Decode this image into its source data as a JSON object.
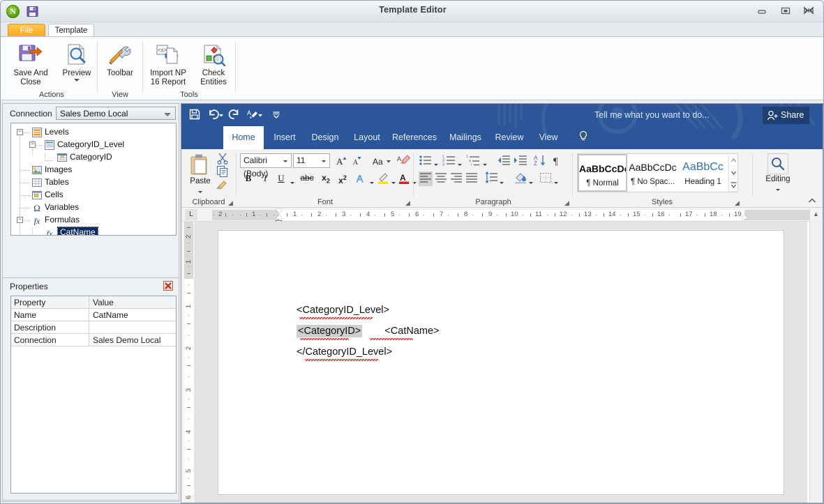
{
  "window": {
    "title": "Template Editor",
    "logo_letter": "N",
    "controls": {
      "minimize": "minimize-button",
      "maximize": "maximize-button",
      "close": "close-button"
    }
  },
  "outer_tabs": [
    {
      "label": "File",
      "active": false
    },
    {
      "label": "Template",
      "active": true
    }
  ],
  "outer_ribbon": {
    "groups": [
      {
        "label": "Actions",
        "buttons": [
          {
            "label_line1": "Save And",
            "label_line2": "Close",
            "icon": "save-and-close-icon",
            "caret": false
          },
          {
            "label_line1": "Preview",
            "label_line2": "",
            "icon": "preview-icon",
            "caret": true
          }
        ]
      },
      {
        "label": "View",
        "buttons": [
          {
            "label_line1": "Toolbar",
            "label_line2": "",
            "icon": "toolbar-icon",
            "caret": false
          }
        ]
      },
      {
        "label": "Tools",
        "buttons": [
          {
            "label_line1": "Import NP",
            "label_line2": "16 Report",
            "icon": "import-report-icon",
            "caret": false
          },
          {
            "label_line1": "Check",
            "label_line2": "Entities",
            "icon": "check-entities-icon",
            "caret": false
          }
        ]
      }
    ]
  },
  "left_panel": {
    "connection_label": "Connection",
    "connection_value": "Sales Demo Local",
    "tree": [
      {
        "label": "Levels",
        "depth": 0,
        "icon": "levels-icon",
        "expander": "-",
        "selected": false
      },
      {
        "label": "CategoryID_Level",
        "depth": 1,
        "icon": "level-icon",
        "expander": "-",
        "selected": false
      },
      {
        "label": "CategoryID",
        "depth": 2,
        "icon": "table-icon",
        "expander": "",
        "selected": false
      },
      {
        "label": "Images",
        "depth": 0,
        "icon": "image-icon",
        "expander": "",
        "selected": false
      },
      {
        "label": "Tables",
        "depth": 0,
        "icon": "tables-icon",
        "expander": "",
        "selected": false
      },
      {
        "label": "Cells",
        "depth": 0,
        "icon": "cells-icon",
        "expander": "",
        "selected": false
      },
      {
        "label": "Variables",
        "depth": 0,
        "icon": "omega-icon",
        "expander": "",
        "selected": false
      },
      {
        "label": "Formulas",
        "depth": 0,
        "icon": "fx-icon",
        "expander": "-",
        "selected": false
      },
      {
        "label": "CatName",
        "depth": 1,
        "icon": "fx-icon",
        "expander": "",
        "selected": true
      }
    ]
  },
  "properties": {
    "title": "Properties",
    "close_label": "close-properties",
    "headers": [
      "Property",
      "Value"
    ],
    "rows": [
      {
        "property": "Name",
        "value": "CatName"
      },
      {
        "property": "Description",
        "value": ""
      },
      {
        "property": "Connection",
        "value": "Sales Demo Local"
      }
    ]
  },
  "word": {
    "quick_access": [
      "save-icon",
      "undo-icon",
      "redo-icon",
      "format-painter-icon",
      "customize-qat-icon"
    ],
    "tabs": [
      {
        "label": "Home",
        "active": true
      },
      {
        "label": "Insert",
        "active": false
      },
      {
        "label": "Design",
        "active": false
      },
      {
        "label": "Layout",
        "active": false
      },
      {
        "label": "References",
        "active": false
      },
      {
        "label": "Mailings",
        "active": false
      },
      {
        "label": "Review",
        "active": false
      },
      {
        "label": "View",
        "active": false
      }
    ],
    "tell_me": "Tell me what you want to do...",
    "share": "Share",
    "groups": {
      "clipboard": {
        "label": "Clipboard",
        "paste_label": "Paste"
      },
      "font": {
        "label": "Font",
        "font_name": "Calibri (Body)",
        "font_size": "11"
      },
      "paragraph": {
        "label": "Paragraph"
      },
      "styles": {
        "label": "Styles",
        "items": [
          {
            "preview": "AaBbCcDc",
            "name": "¶ Normal",
            "selected": true,
            "color": "#111"
          },
          {
            "preview": "AaBbCcDc",
            "name": "¶ No Spac...",
            "selected": false,
            "color": "#111"
          },
          {
            "preview": "AaBbCc",
            "name": "Heading 1",
            "selected": false,
            "color": "#2e74b5"
          }
        ]
      },
      "editing": {
        "label": "Editing"
      }
    },
    "ruler": {
      "left_numbers": [
        "2",
        "1"
      ],
      "right_numbers": [
        "1",
        "2",
        "3",
        "4",
        "5",
        "6",
        "7",
        "8",
        "9",
        "10",
        "11",
        "12",
        "13",
        "14",
        "15",
        "16",
        "17",
        "18",
        "19"
      ],
      "vertical_top": [
        "2",
        "1"
      ],
      "vertical_numbers": [
        "1",
        "2",
        "3",
        "4",
        "5",
        "6"
      ],
      "tab_stop": "L"
    },
    "document": {
      "lines": [
        {
          "text": "<CategoryID_Level>",
          "selected": false,
          "spell_error": true
        },
        {
          "text": "<CategoryID>",
          "selected": true,
          "spell_error": true
        },
        {
          "text": "<CatName>",
          "selected": false,
          "spell_error": true
        },
        {
          "text": "</CategoryID_Level>",
          "selected": false,
          "spell_error": true
        }
      ]
    }
  },
  "colors": {
    "word_blue": "#2b579a",
    "share_blue": "#1e3f72",
    "file_tab_orange": "#f8a617",
    "selection_navy": "#0b2a62",
    "spell_red": "#e02020"
  }
}
